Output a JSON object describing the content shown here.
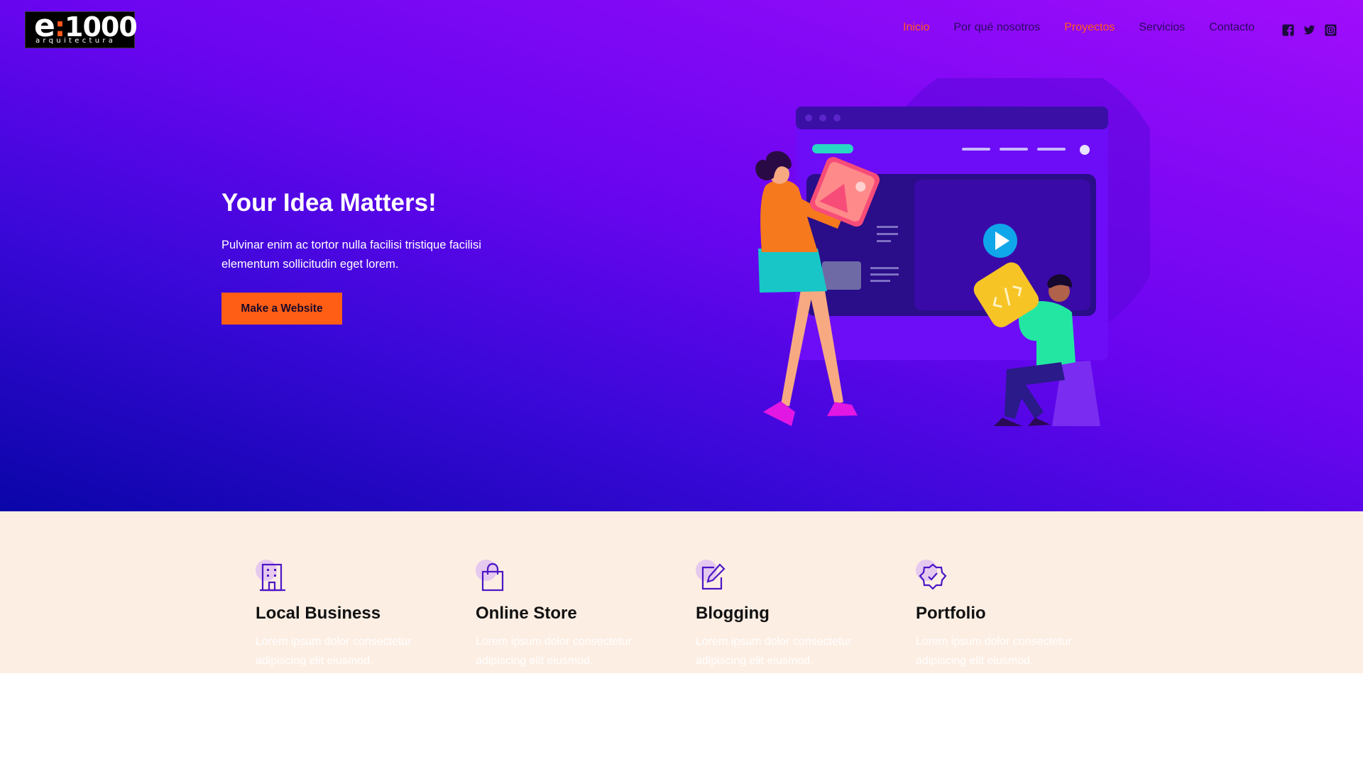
{
  "header": {
    "logo_main": "1000",
    "logo_e": "e",
    "logo_colon": ":",
    "logo_sub": "arquitectura",
    "nav": [
      {
        "label": "Inicio",
        "active": true
      },
      {
        "label": "Por qué nosotros",
        "active": false
      },
      {
        "label": "Proyectos",
        "active": true
      },
      {
        "label": "Servicios",
        "active": false
      },
      {
        "label": "Contacto",
        "active": false
      }
    ],
    "social": [
      "facebook-icon",
      "twitter-icon",
      "instagram-icon"
    ]
  },
  "hero": {
    "title": "Your Idea Matters!",
    "text": "Pulvinar enim ac tortor nulla facilisi tristique facilisi elementum sollicitudin eget lorem.",
    "button": "Make a Website",
    "colors": {
      "gradient_start": "#0a06a8",
      "gradient_end": "#a00dfb",
      "accent": "#ff5e14"
    }
  },
  "features": [
    {
      "icon": "building-icon",
      "title": "Local Business",
      "text": "Lorem ipsum dolor consectetur adipiscing elit eiusmod."
    },
    {
      "icon": "shopping-bag-icon",
      "title": "Online Store",
      "text": "Lorem ipsum dolor consectetur adipiscing elit eiusmod."
    },
    {
      "icon": "edit-icon",
      "title": "Blogging",
      "text": "Lorem ipsum dolor consectetur adipiscing elit eiusmod."
    },
    {
      "icon": "badge-check-icon",
      "title": "Portfolio",
      "text": "Lorem ipsum dolor consectetur adipiscing elit eiusmod."
    }
  ]
}
